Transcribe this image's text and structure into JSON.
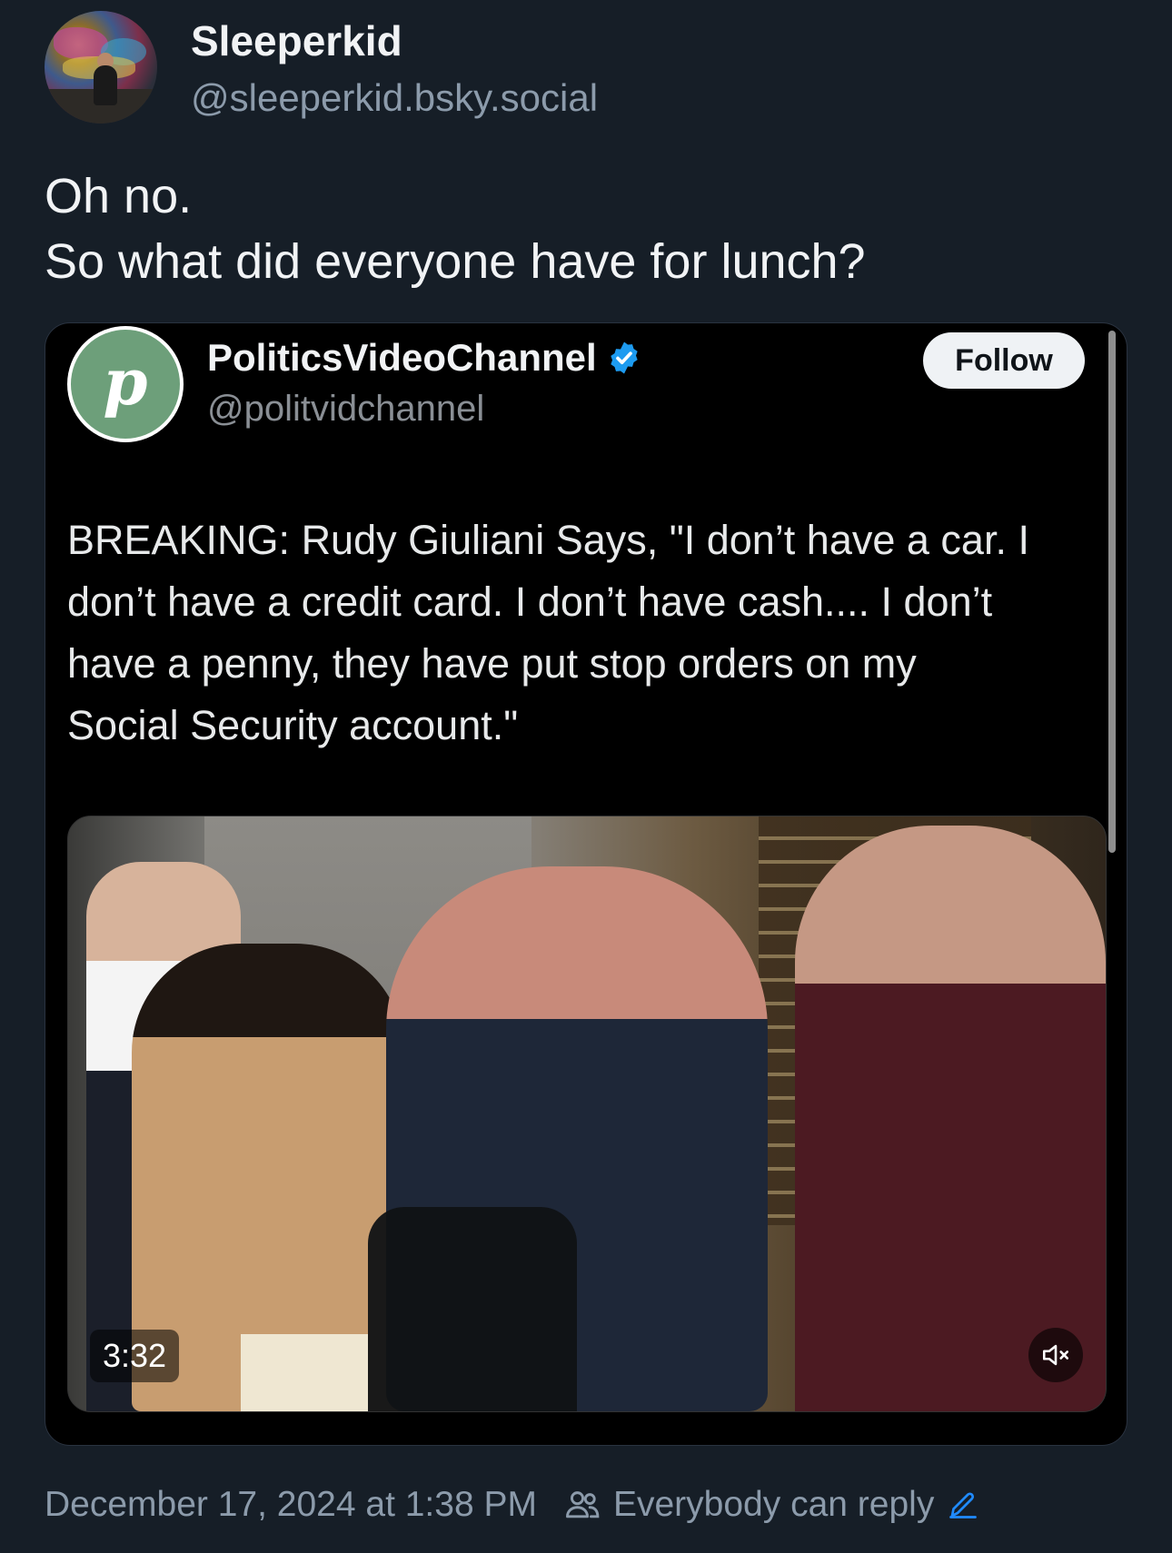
{
  "post": {
    "author_name": "Sleeperkid",
    "author_handle": "@sleeperkid.bsky.social",
    "text_lines": [
      "Oh no.",
      "So what did everyone have for lunch?"
    ]
  },
  "embed": {
    "avatar_letter": "p",
    "name": "PoliticsVideoChannel",
    "handle": "@politvidchannel",
    "follow_label": "Follow",
    "text_lines": [
      "BREAKING: Rudy Giuliani Says, \"I don’t have a car. I",
      "don’t have a credit card. I don’t have cash.... I don’t",
      "have a penny, they have put stop orders on my",
      "Social Security account.\""
    ],
    "video": {
      "duration": "3:32",
      "muted": true
    },
    "icons": {
      "verified": "verified-badge-icon",
      "mute": "speaker-muted-icon"
    }
  },
  "footer": {
    "timestamp": "December 17, 2024 at 1:38 PM",
    "reply_setting": "Everybody can reply"
  },
  "colors": {
    "background": "#161e27",
    "muted_text": "#8c9bab",
    "accent_blue": "#208bfe",
    "verified_blue": "#1d9bf0",
    "embed_avatar": "#6d9f7a"
  }
}
